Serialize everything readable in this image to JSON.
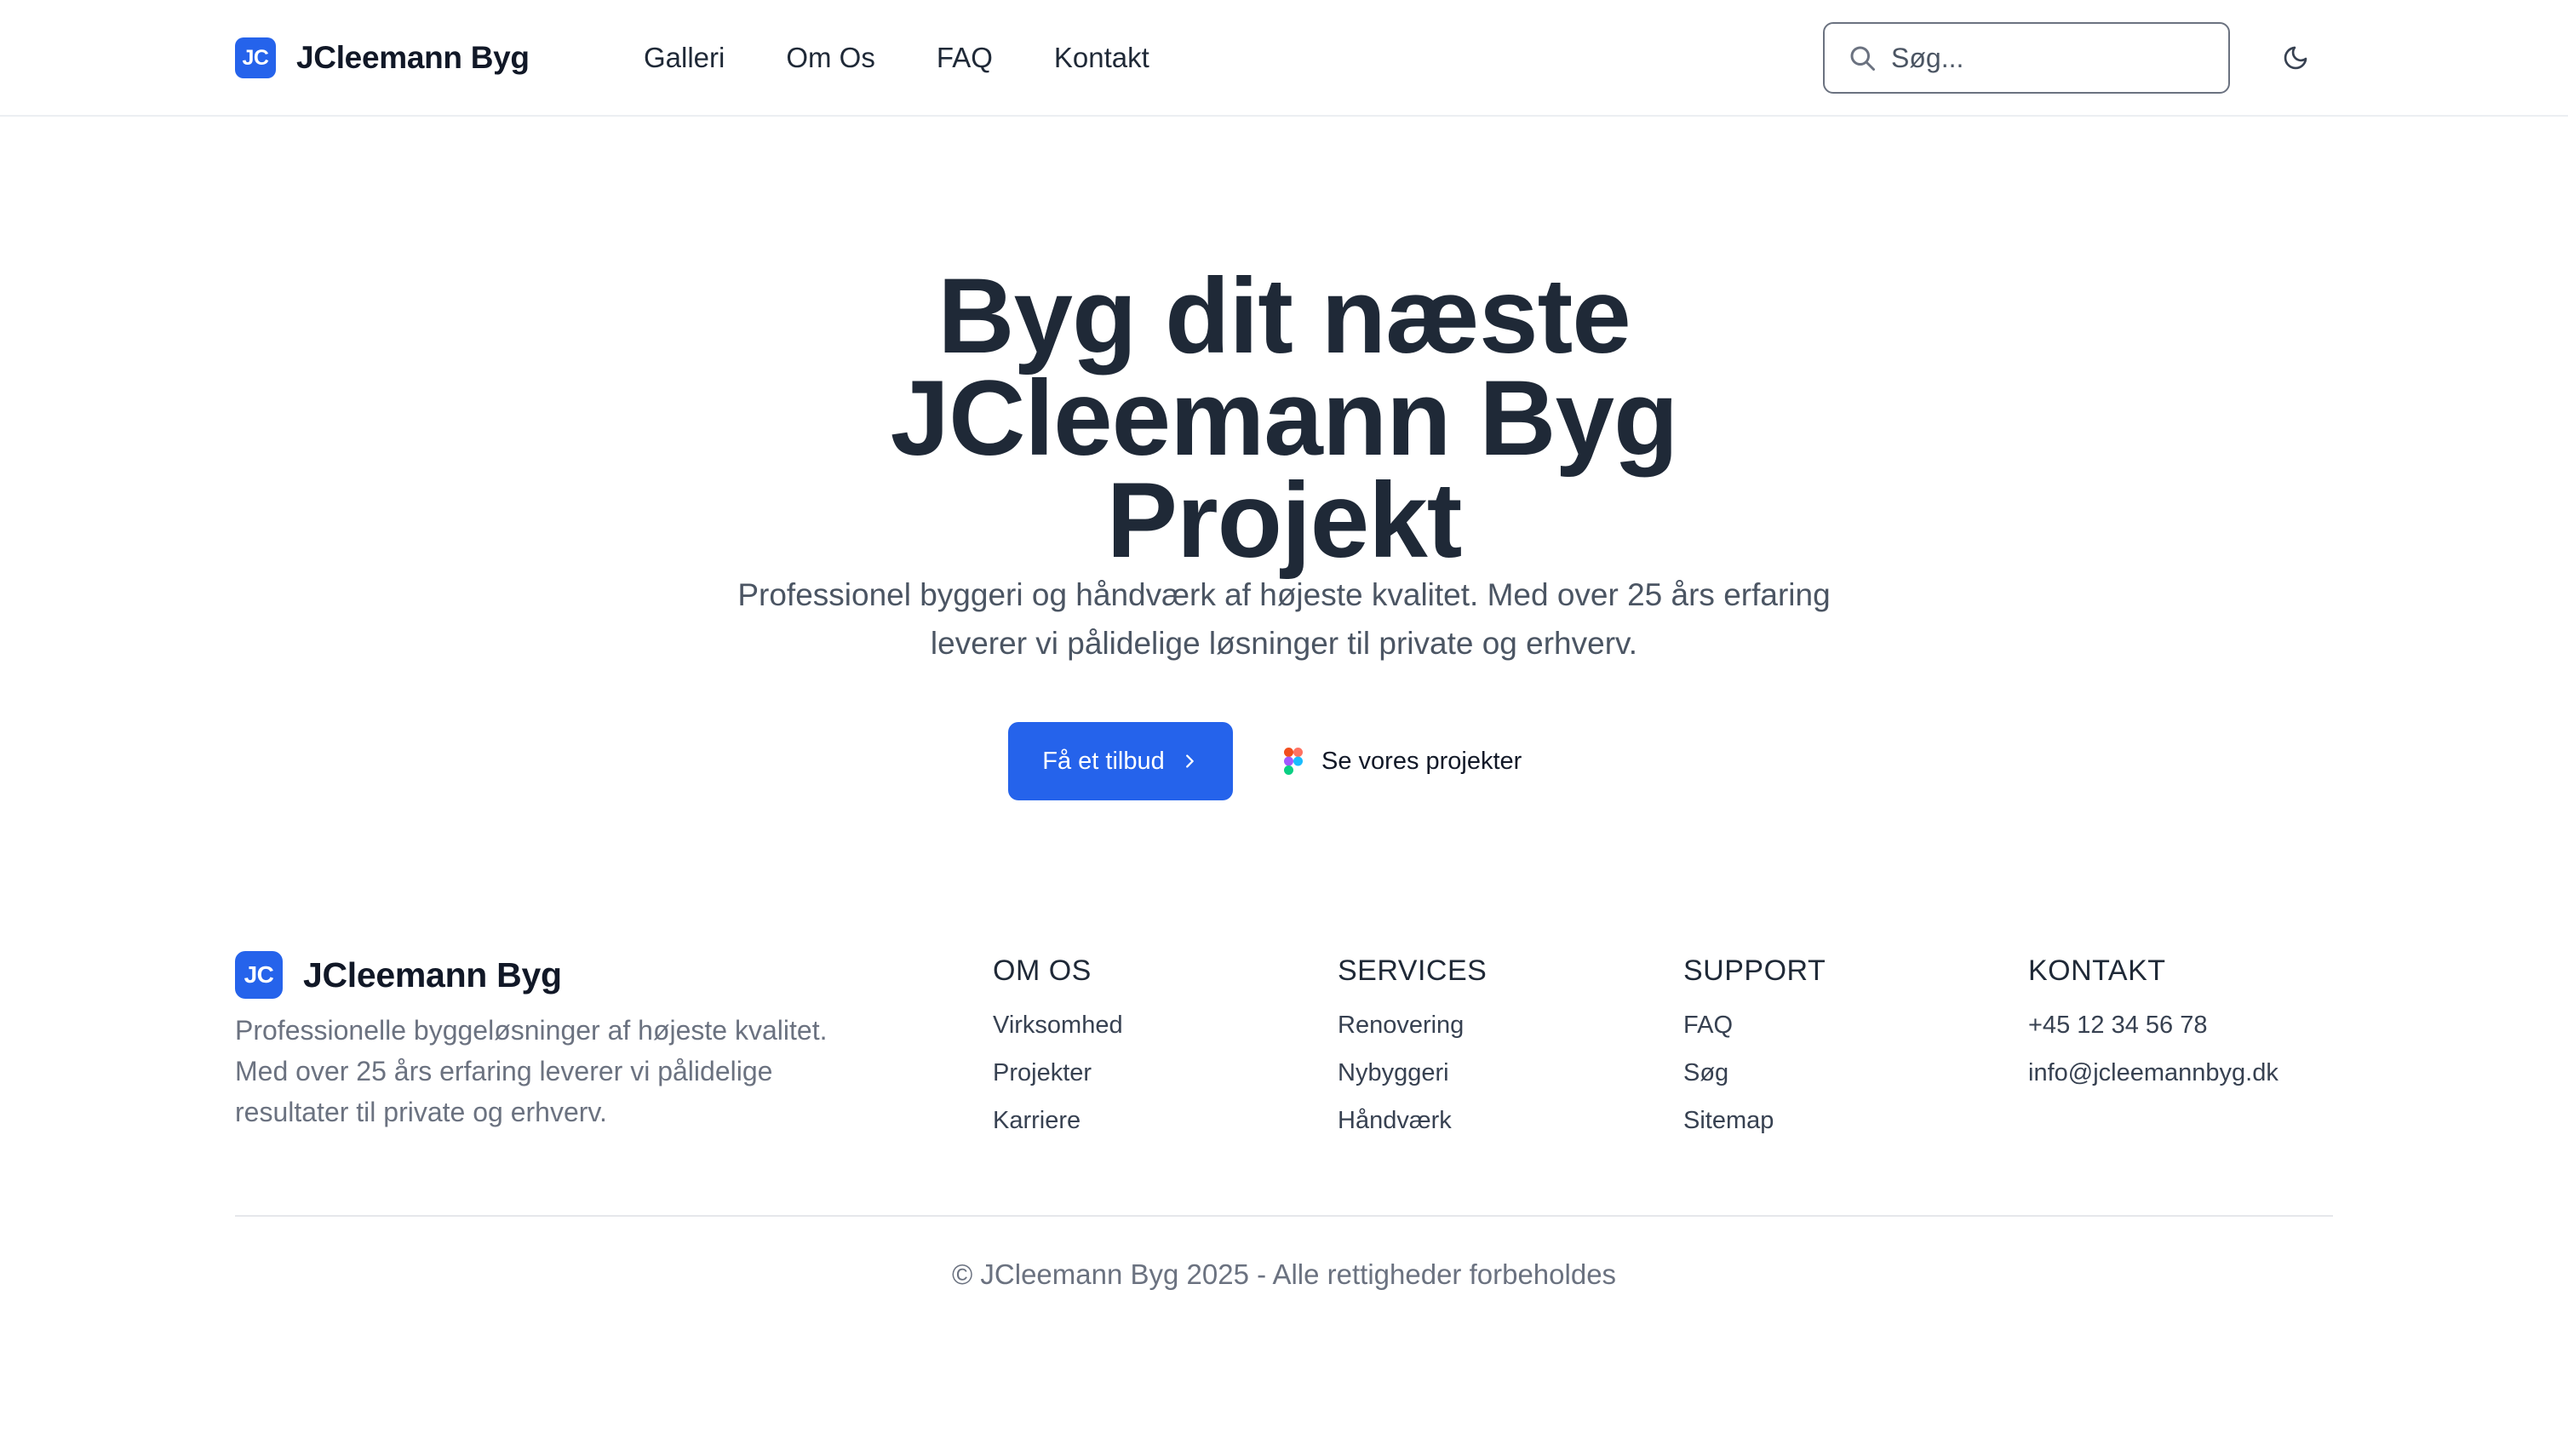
{
  "header": {
    "logo_text": "JC",
    "brand_name": "JCleemann Byg",
    "nav": [
      "Galleri",
      "Om Os",
      "FAQ",
      "Kontakt"
    ],
    "search_placeholder": "Søg..."
  },
  "hero": {
    "title_lines": [
      "Byg dit næste",
      "JCleemann Byg",
      "Projekt"
    ],
    "subtitle_lines": [
      "Professionel byggeri og håndværk af højeste kvalitet. Med over 25 års erfaring",
      "leverer vi pålidelige løsninger til private og erhverv."
    ],
    "cta_label": "Få et tilbud",
    "secondary_label": "Se vores projekter"
  },
  "footer": {
    "logo_text": "JC",
    "brand_name": "JCleemann Byg",
    "description_lines": [
      "Professionelle byggeløsninger af højeste kvalitet.",
      "Med over 25 års erfaring leverer vi pålidelige",
      "resultater til private og erhverv."
    ],
    "columns": [
      {
        "heading": "OM OS",
        "links": [
          "Virksomhed",
          "Projekter",
          "Karriere"
        ]
      },
      {
        "heading": "SERVICES",
        "links": [
          "Renovering",
          "Nybyggeri",
          "Håndværk"
        ]
      },
      {
        "heading": "SUPPORT",
        "links": [
          "FAQ",
          "Søg",
          "Sitemap"
        ]
      },
      {
        "heading": "KONTAKT",
        "links": [
          "+45 12 34 56 78",
          "info@jcleemannbyg.dk"
        ]
      }
    ],
    "copyright": "© JCleemann Byg 2025 - Alle rettigheder forbeholdes"
  },
  "colors": {
    "accent": "#2563eb",
    "text_dark": "#1f2937",
    "text_muted": "#6b7280"
  },
  "icons": {
    "search": "search-icon",
    "theme": "moon-icon",
    "cta": "chevron-right-icon",
    "secondary": "figma-icon"
  }
}
